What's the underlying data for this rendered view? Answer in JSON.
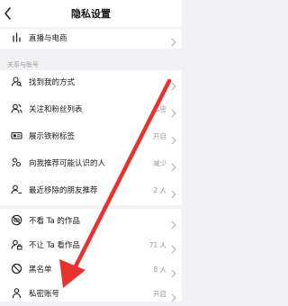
{
  "header": {
    "title": "隐私设置"
  },
  "top_group": {
    "items": [
      {
        "label": "直播与电商",
        "value": "",
        "icon": "bar-chart-icon"
      }
    ]
  },
  "relations": {
    "section_label": "关系与账号",
    "items": [
      {
        "label": "找到我的方式",
        "value": "",
        "icon": "person-search-icon"
      },
      {
        "label": "关注和粉丝列表",
        "value": "私密",
        "icon": "followers-icon"
      },
      {
        "label": "展示铁粉标签",
        "value": "开启",
        "icon": "badge-icon"
      },
      {
        "label": "向我推荐可能认识的人",
        "value": "减少",
        "icon": "contacts-icon"
      },
      {
        "label": "最近移除的朋友推荐",
        "value": "2 人",
        "icon": "remove-user-icon"
      }
    ]
  },
  "blocking": {
    "items": [
      {
        "label": "不看 Ta 的作品",
        "value": "",
        "icon": "eye-off-icon"
      },
      {
        "label": "不让 Ta 看作品",
        "value": "71 人",
        "icon": "person-lock-icon"
      },
      {
        "label": "黑名单",
        "value": "8 人",
        "icon": "block-icon"
      },
      {
        "label": "私密账号",
        "value": "开启",
        "icon": "lock-person-icon"
      }
    ]
  },
  "annotation": {
    "color": "#e8322e",
    "icon": "red-arrow-icon"
  }
}
